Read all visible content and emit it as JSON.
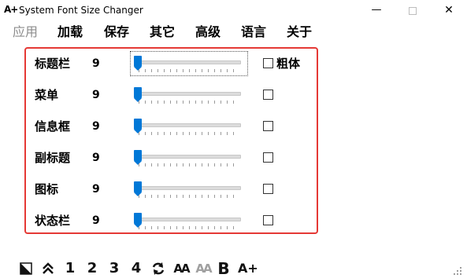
{
  "window": {
    "title": "System Font Size Changer",
    "icon": "A+",
    "minimize_glyph": "—",
    "close_glyph": "✕"
  },
  "menu": {
    "items": [
      {
        "label": "应用",
        "disabled": true
      },
      {
        "label": "加载",
        "disabled": false
      },
      {
        "label": "保存",
        "disabled": false
      },
      {
        "label": "其它",
        "disabled": false
      },
      {
        "label": "高级",
        "disabled": false
      },
      {
        "label": "语言",
        "disabled": false
      },
      {
        "label": "关于",
        "disabled": false
      }
    ]
  },
  "rows": [
    {
      "label": "标题栏",
      "value": "9",
      "checkbox_label": "粗体",
      "checked": false
    },
    {
      "label": "菜单",
      "value": "9",
      "checked": false
    },
    {
      "label": "信息框",
      "value": "9",
      "checked": false
    },
    {
      "label": "副标题",
      "value": "9",
      "checked": false
    },
    {
      "label": "图标",
      "value": "9",
      "checked": false
    },
    {
      "label": "状态栏",
      "value": "9",
      "checked": false
    }
  ],
  "slider_level": 0,
  "colors": {
    "panel_border": "#e53935",
    "slider_thumb": "#0078d7",
    "disabled_text": "#8c8c8c"
  },
  "toolbar": {
    "preset_1": "1",
    "preset_2": "2",
    "preset_3": "3",
    "preset_4": "4",
    "font_aa": "AA",
    "font_aa_gray": "AA",
    "bold": "B",
    "larger": "A+"
  }
}
